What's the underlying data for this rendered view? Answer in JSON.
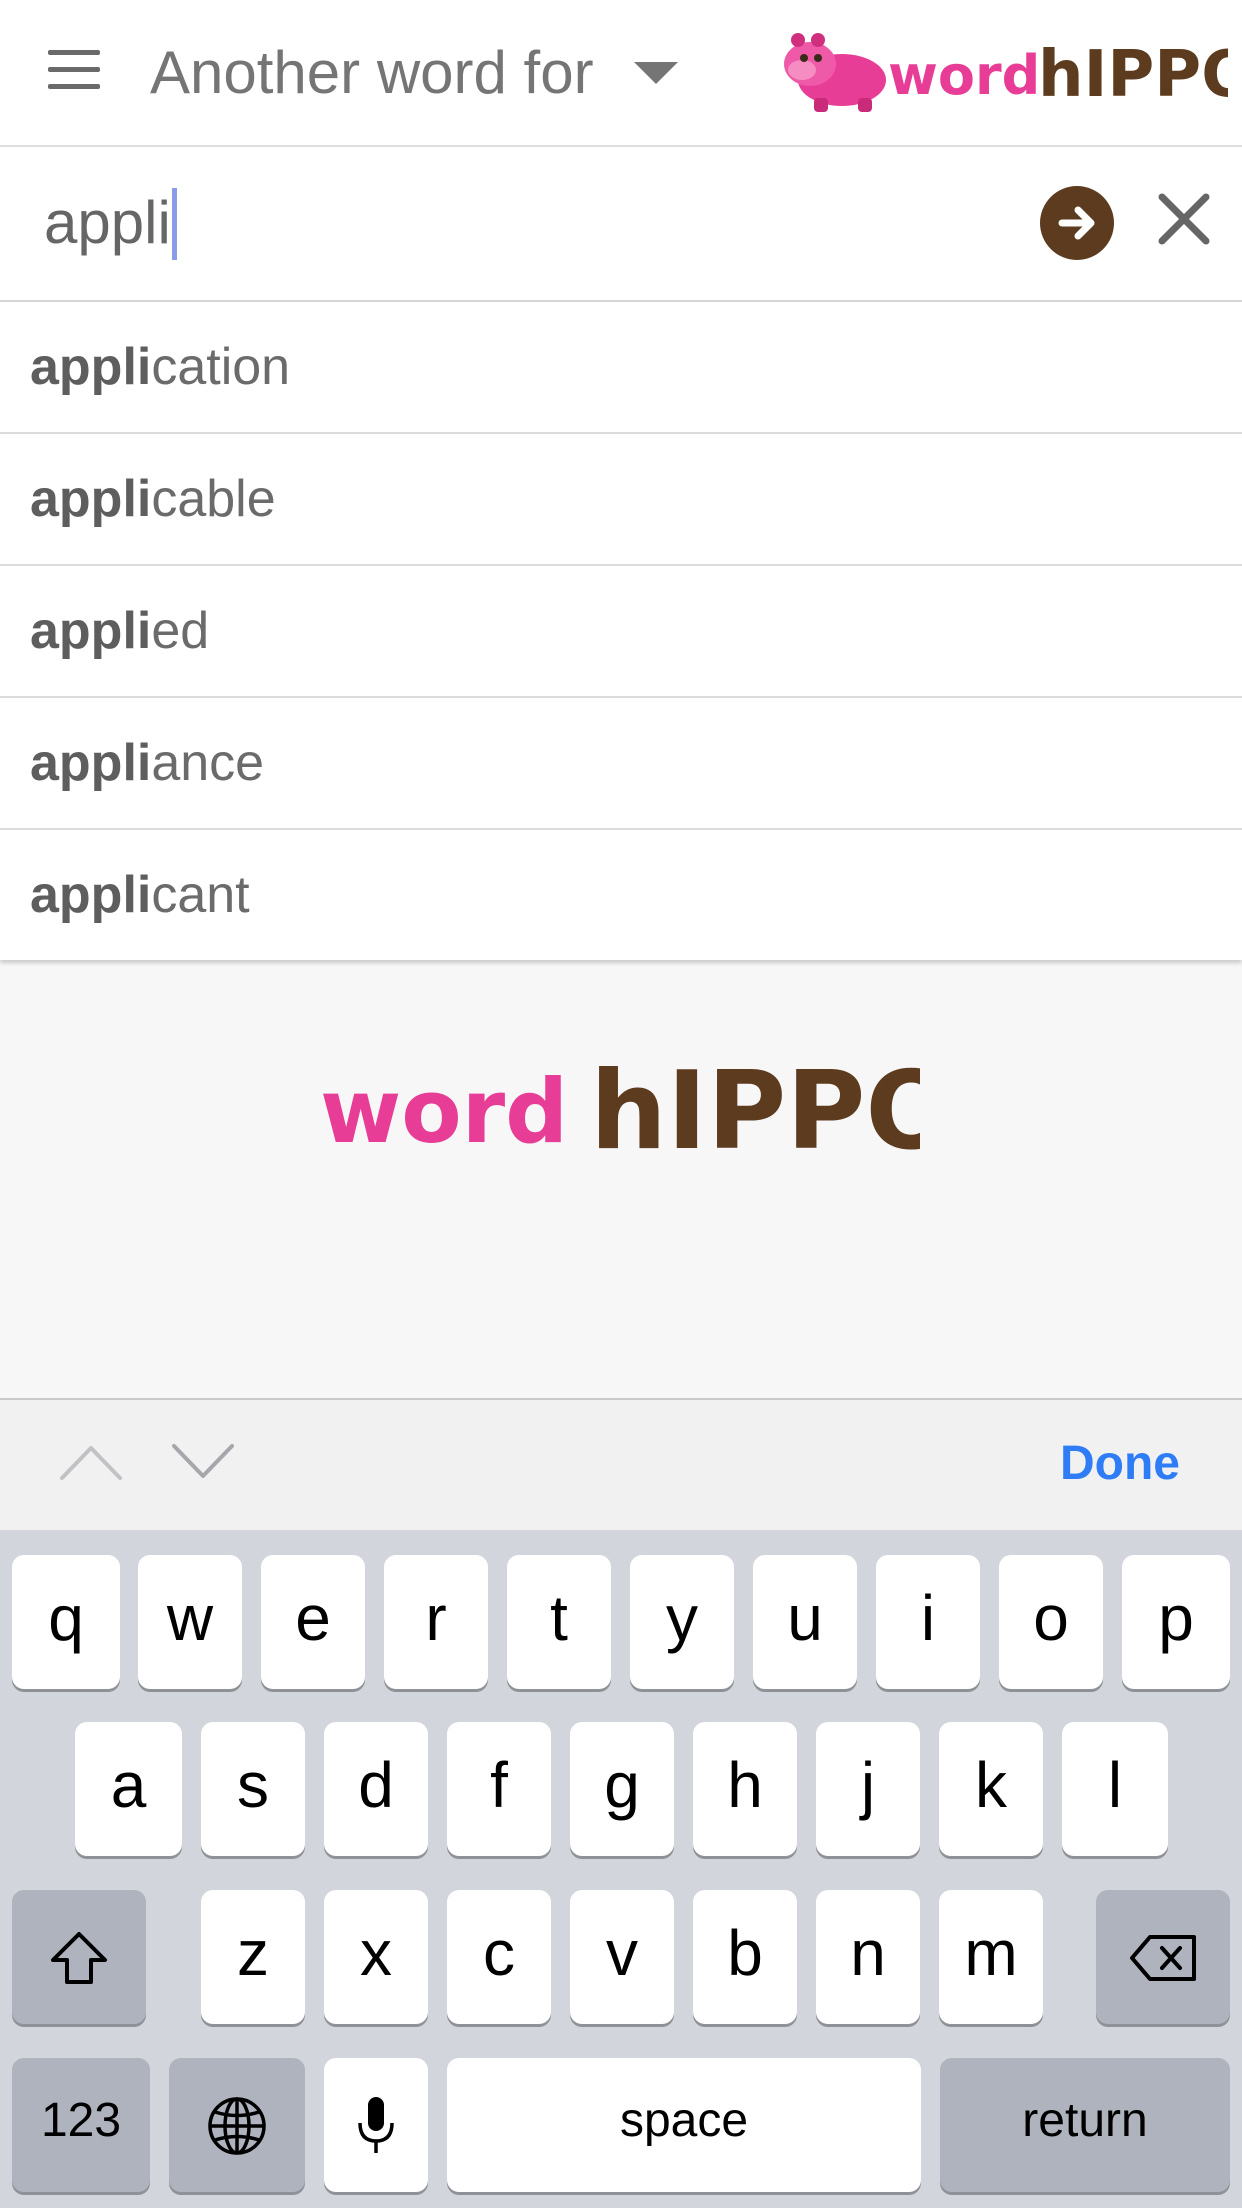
{
  "header": {
    "title": "Another word for",
    "logo_word": "word",
    "logo_hippo": "hIPPO",
    "menu_icon": "hamburger-menu-icon",
    "dropdown_icon": "caret-down-icon"
  },
  "search": {
    "value": "appli",
    "go_icon": "arrow-right-circle-icon",
    "clear_icon": "close-icon"
  },
  "suggestions": [
    {
      "match": "appli",
      "rest": "cation"
    },
    {
      "match": "appli",
      "rest": "cable"
    },
    {
      "match": "appli",
      "rest": "ed"
    },
    {
      "match": "appli",
      "rest": "ance"
    },
    {
      "match": "appli",
      "rest": "cant"
    }
  ],
  "main_logo": {
    "word": "word",
    "hippo": "hIPPO"
  },
  "accessory": {
    "done_label": "Done",
    "prev_icon": "chevron-up-icon",
    "next_icon": "chevron-down-icon"
  },
  "keyboard": {
    "row1": [
      "q",
      "w",
      "e",
      "r",
      "t",
      "y",
      "u",
      "i",
      "o",
      "p"
    ],
    "row2": [
      "a",
      "s",
      "d",
      "f",
      "g",
      "h",
      "j",
      "k",
      "l"
    ],
    "row3": [
      "z",
      "x",
      "c",
      "v",
      "b",
      "n",
      "m"
    ],
    "numbers_label": "123",
    "space_label": "space",
    "return_label": "return",
    "shift_icon": "shift-icon",
    "delete_icon": "backspace-icon",
    "globe_icon": "globe-icon",
    "mic_icon": "microphone-icon"
  },
  "colors": {
    "brand_pink": "#e83d96",
    "brand_brown": "#5c3b1f",
    "accent_blue": "#2f7df6"
  }
}
